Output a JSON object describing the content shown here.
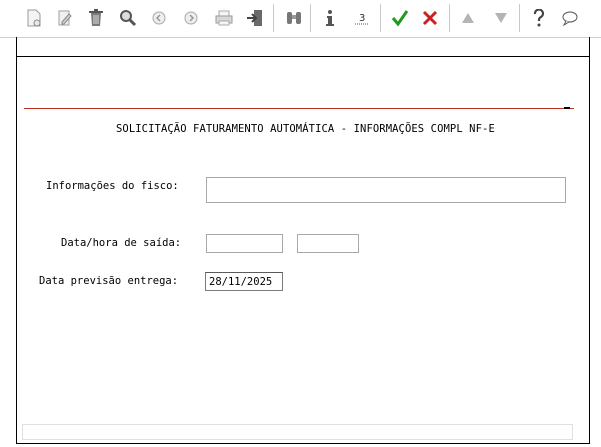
{
  "toolbar": {
    "icons": [
      {
        "name": "new-document-icon",
        "enabled": false
      },
      {
        "name": "edit-icon",
        "enabled": false
      },
      {
        "name": "trash-icon",
        "enabled": true
      },
      {
        "name": "search-icon",
        "enabled": true
      },
      {
        "name": "previous-icon",
        "enabled": false
      },
      {
        "name": "next-icon",
        "enabled": false
      },
      {
        "name": "print-icon",
        "enabled": false
      },
      {
        "name": "exit-icon",
        "enabled": true
      },
      {
        "name": "binoculars-icon",
        "enabled": true
      },
      {
        "name": "info-icon",
        "enabled": true
      },
      {
        "name": "numbered-icon",
        "enabled": true
      },
      {
        "name": "confirm-check-icon",
        "enabled": true
      },
      {
        "name": "cancel-x-icon",
        "enabled": true
      },
      {
        "name": "arrow-up-icon",
        "enabled": false
      },
      {
        "name": "arrow-down-icon",
        "enabled": false
      },
      {
        "name": "help-icon",
        "enabled": true
      },
      {
        "name": "comment-icon",
        "enabled": true
      }
    ],
    "numbered_icon_text": "3"
  },
  "form": {
    "title": "SOLICITAÇÃO FATURAMENTO AUTOMÁTICA - INFORMAÇÕES COMPL NF-E",
    "fisco_label": "Informações do fisco:",
    "fisco_value": "",
    "saida_label": "Data/hora de saída:",
    "saida_date_value": "",
    "saida_time_value": "",
    "previsao_label": "Data previsão entrega:",
    "previsao_value": "28/11/2025"
  },
  "colors": {
    "rule": "#b8321e",
    "check": "#1f9a1f",
    "cancel": "#cc1f1f"
  }
}
